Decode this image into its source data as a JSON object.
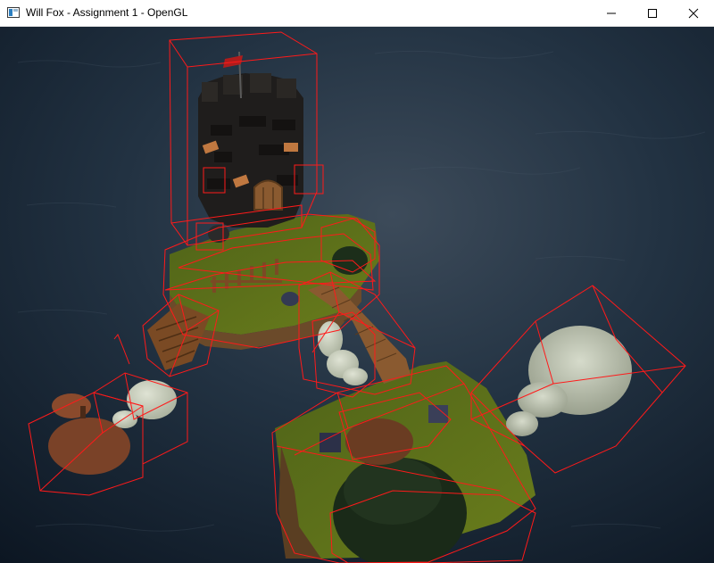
{
  "window": {
    "title": "Will Fox - Assignment 1 - OpenGL",
    "icon": "opengl-app-icon",
    "controls": [
      "minimize-icon",
      "maximize-icon",
      "close-icon"
    ]
  },
  "scene": {
    "description_icons": [
      "castle-tower",
      "flag",
      "island-grass",
      "wooden-bridge",
      "trees",
      "clouds",
      "bounding-boxes"
    ],
    "colors": {
      "water_dark": "#0f1c2a",
      "water_light": "#3a4a5a",
      "grass": "#5a6e1a",
      "tower": "#1f1d1c",
      "wood": "#7a4a24",
      "cloud": "#c9cfbf",
      "bbox": "#ff1a1a",
      "tree": "#1c2e1a"
    }
  }
}
